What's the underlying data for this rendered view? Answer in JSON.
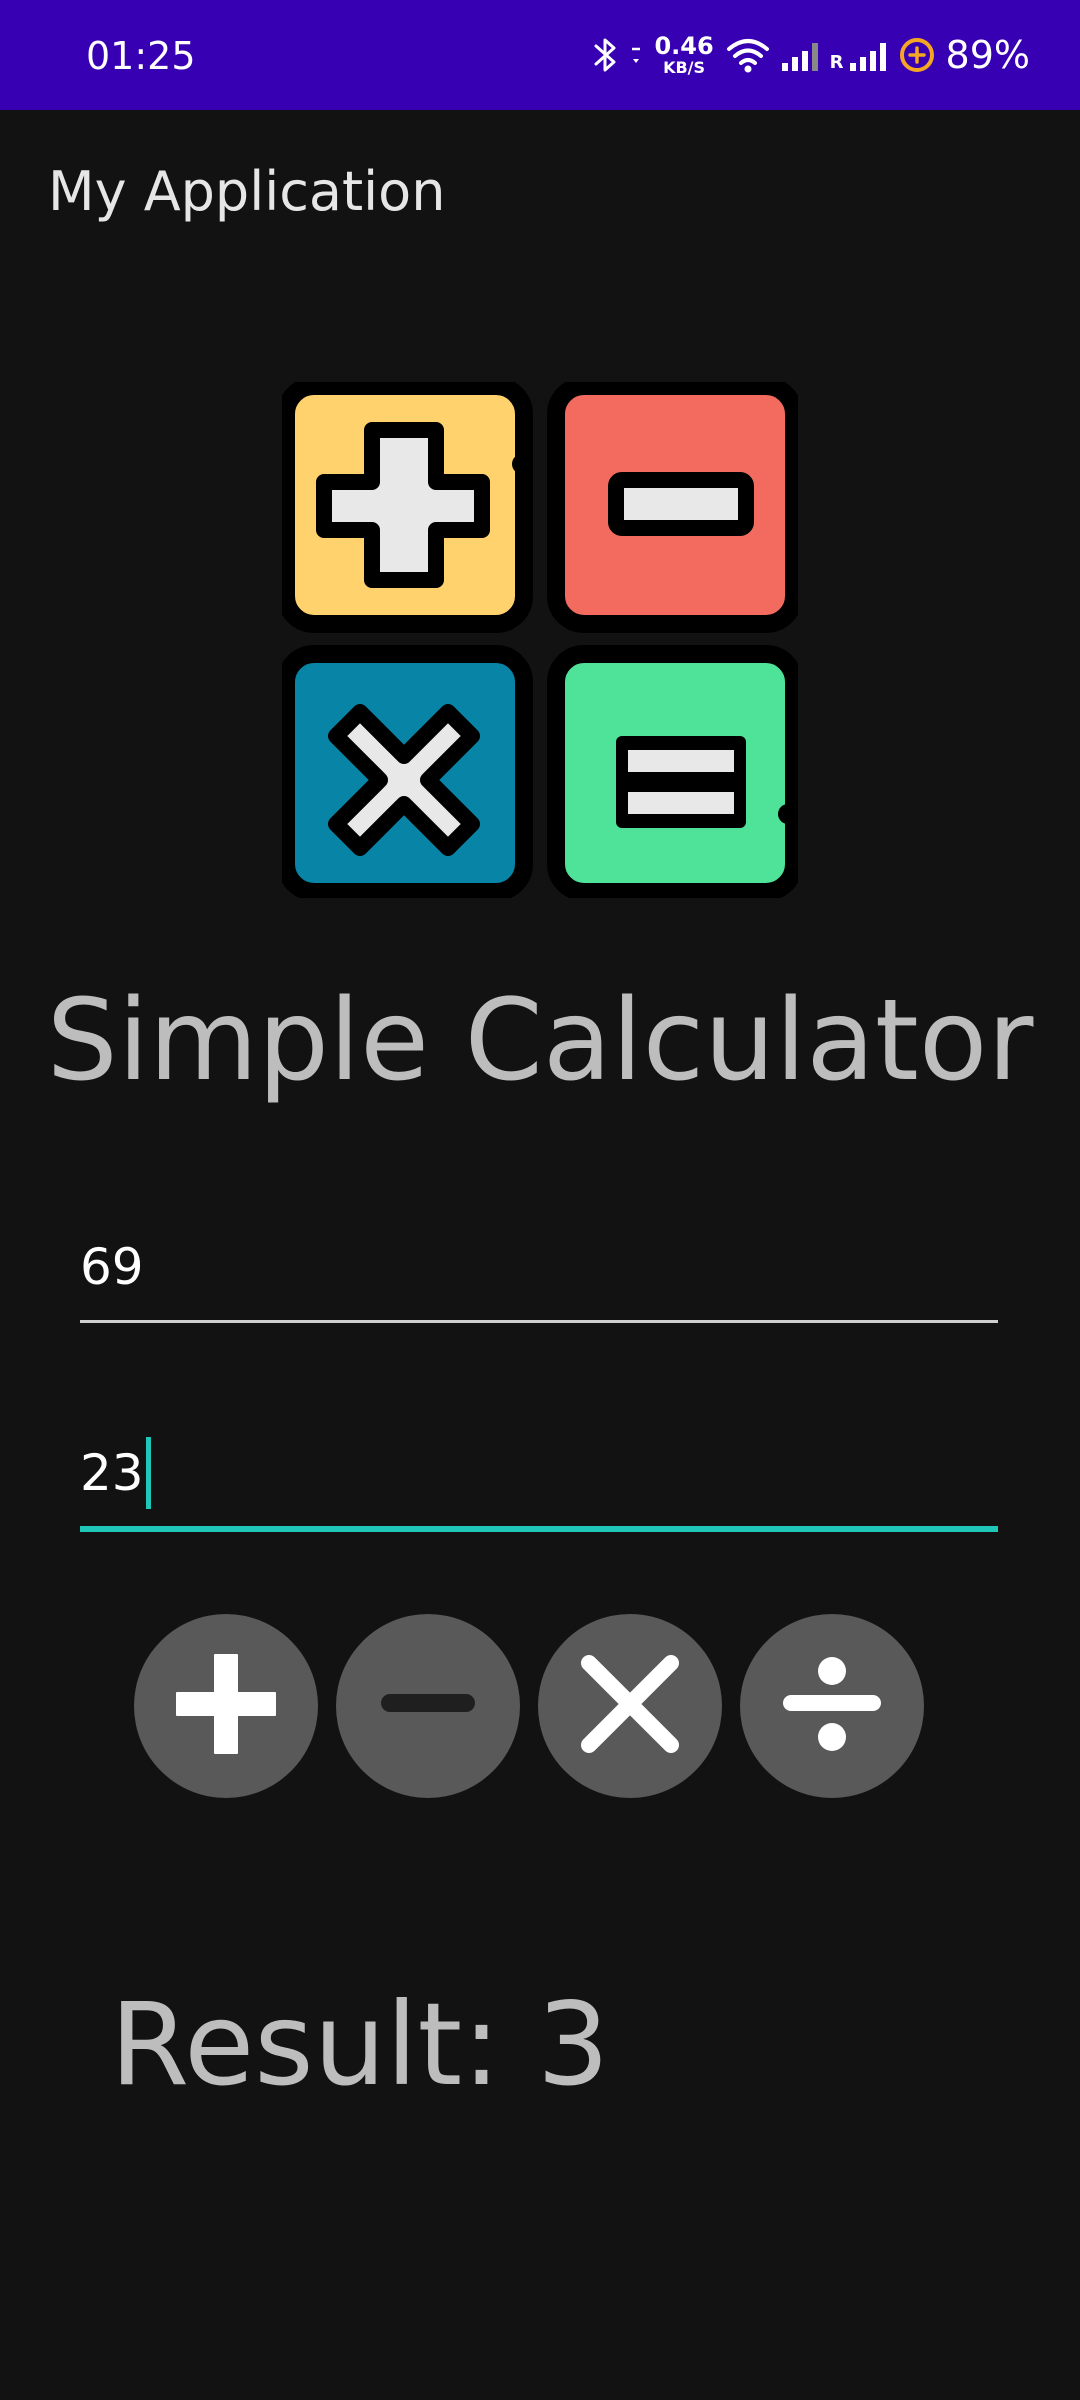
{
  "status_bar": {
    "time": "01:25",
    "net_speed_value": "0.46",
    "net_speed_unit": "KB/S",
    "roaming_label": "R",
    "battery_percent": "89%",
    "background_color": "#3700b3",
    "icons": [
      "bluetooth-icon",
      "wifi-icon",
      "signal-icon",
      "signal-roaming-icon",
      "battery-saver-icon"
    ]
  },
  "app_bar": {
    "title": "My Application"
  },
  "logo": {
    "icon": "calculator-logo-icon",
    "colors": {
      "plus_tile": "#ffd26e",
      "minus_tile": "#f26b5e",
      "times_tile": "#0784a6",
      "equals_tile": "#4fe39a"
    }
  },
  "main": {
    "heading": "Simple Calculator",
    "first_number": "69",
    "second_number": "23",
    "active_field_color": "#1ec7b7",
    "result": "Result: 3"
  },
  "operations": [
    {
      "name": "add",
      "icon": "plus-icon"
    },
    {
      "name": "subtract",
      "icon": "minus-icon"
    },
    {
      "name": "multiply",
      "icon": "multiply-icon"
    },
    {
      "name": "divide",
      "icon": "divide-icon"
    }
  ]
}
